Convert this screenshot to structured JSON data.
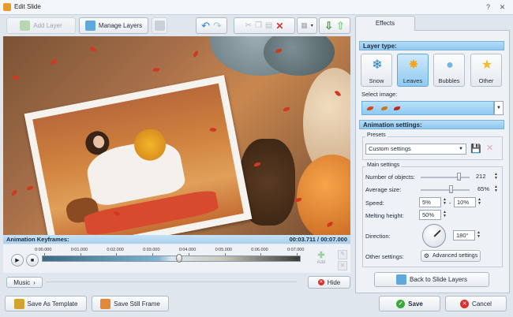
{
  "window": {
    "title": "Edit Slide",
    "controls": [
      "?",
      "✕"
    ]
  },
  "toolbar": {
    "add_layer": "Add Layer",
    "manage_layers": "Manage Layers"
  },
  "tabs": {
    "effects": "Effects"
  },
  "layer_type": {
    "header": "Layer type:",
    "options": [
      {
        "label": "Snow",
        "icon": "snowflake-icon",
        "selected": false
      },
      {
        "label": "Leaves",
        "icon": "maple-leaf-icon",
        "selected": true
      },
      {
        "label": "Bubbles",
        "icon": "bubble-icon",
        "selected": false
      },
      {
        "label": "Other",
        "icon": "star-heart-icon",
        "selected": false
      }
    ]
  },
  "select_image": {
    "label": "Select image:"
  },
  "animation_settings": {
    "header": "Animation settings:",
    "presets_label": "Presets",
    "preset_value": "Custom settings",
    "main_settings_label": "Main settings",
    "number_of_objects": {
      "label": "Number of objects:",
      "value": "212",
      "slider_fraction": 0.78
    },
    "average_size": {
      "label": "Average size:",
      "value": "65%",
      "slider_fraction": 0.62
    },
    "speed": {
      "label": "Speed:",
      "min": "5%",
      "dash": "-",
      "max": "10%"
    },
    "melting_height": {
      "label": "Melting height:",
      "value": "50%"
    },
    "direction": {
      "label": "Direction:",
      "value": "180°"
    },
    "other_settings": {
      "label": "Other settings:",
      "button": "Advanced settings"
    }
  },
  "back_button": "Back to Slide Layers",
  "keyframes": {
    "label": "Animation Keyframes:",
    "time": "00:03.711 / 00:07.000",
    "ticks": [
      "0:00.000",
      "0:01.000",
      "0:02.000",
      "0:03.000",
      "0:04.000",
      "0:05.000",
      "0:06.000",
      "0:07.000"
    ],
    "playhead_fraction": 0.53,
    "add_label": "Add"
  },
  "music_button": "Music",
  "hide_button": "Hide",
  "bottom": {
    "save_template": "Save As Template",
    "save_still": "Save Still Frame",
    "save": "Save",
    "cancel": "Cancel"
  },
  "colors": {
    "accent": "#8ec7ee",
    "save_icon": "#3aa83a",
    "cancel_icon": "#d9302a"
  }
}
